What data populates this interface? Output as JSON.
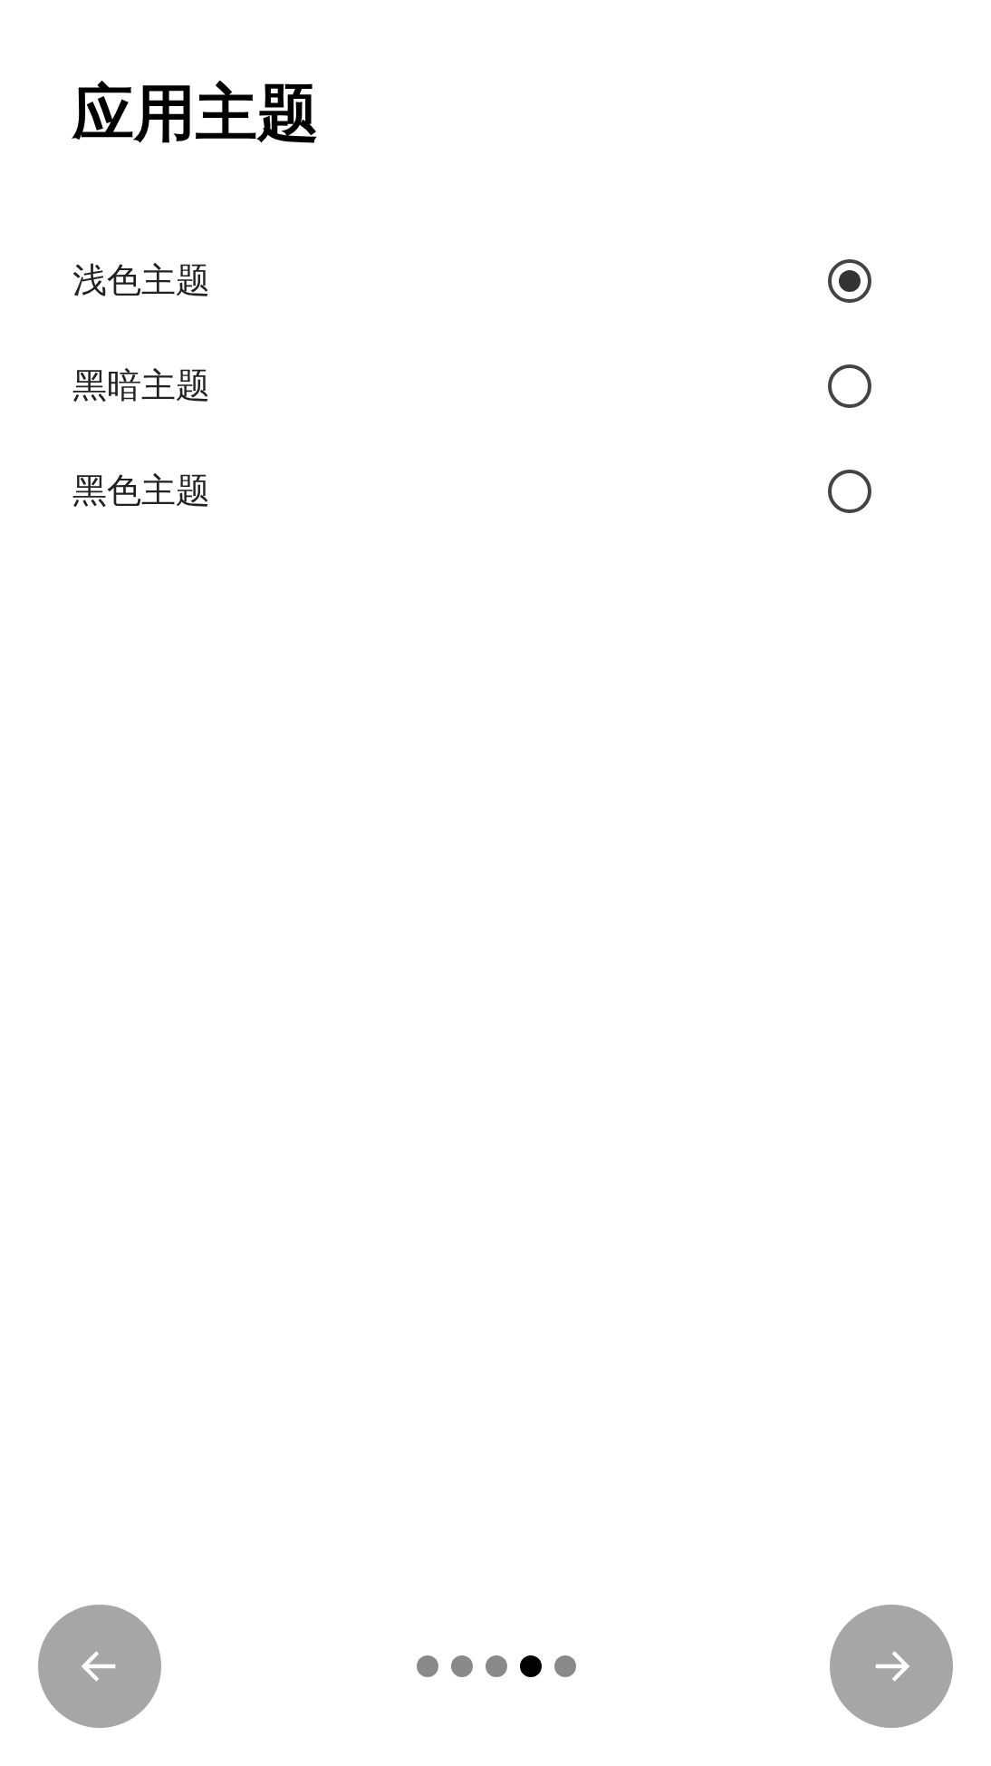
{
  "title": "应用主题",
  "options": [
    {
      "label": "浅色主题",
      "selected": true
    },
    {
      "label": "黑暗主题",
      "selected": false
    },
    {
      "label": "黑色主题",
      "selected": false
    }
  ],
  "pager": [
    {
      "selected": false
    },
    {
      "selected": false
    },
    {
      "selected": false
    },
    {
      "selected": true
    },
    {
      "selected": false
    }
  ]
}
